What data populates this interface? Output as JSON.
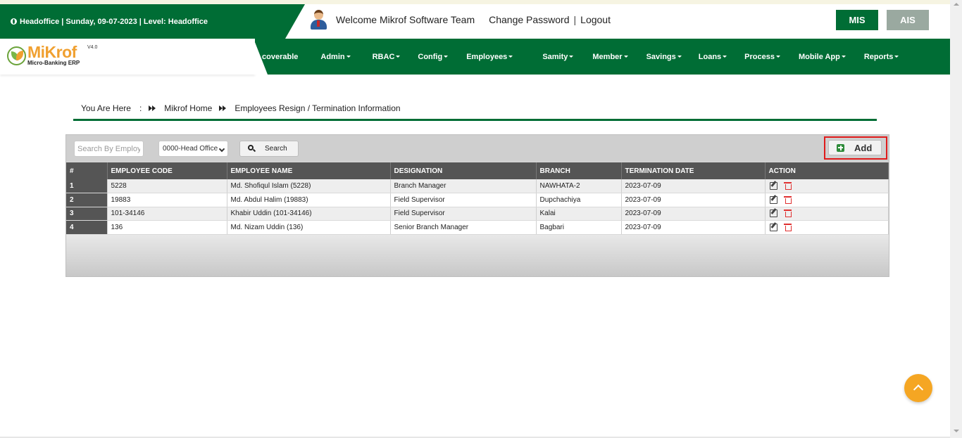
{
  "topbar": {
    "info": "Headoffice | Sunday, 09-07-2023 | Level: Headoffice",
    "welcome": "Welcome Mikrof Software Team",
    "change_password": "Change Password",
    "separator": "|",
    "logout": "Logout",
    "mis_label": "MIS",
    "ais_label": "AIS"
  },
  "logo": {
    "name": "MiKrof",
    "version": "V4.0",
    "subtitle": "Micro-Banking ERP"
  },
  "menu": [
    {
      "label": "coverable",
      "caret": false
    },
    {
      "label": "Admin",
      "caret": true
    },
    {
      "label": "RBAC",
      "caret": true
    },
    {
      "label": "Config",
      "caret": true
    },
    {
      "label": "Employees",
      "caret": true
    },
    {
      "label": "Samity",
      "caret": true
    },
    {
      "label": "Member",
      "caret": true
    },
    {
      "label": "Savings",
      "caret": true
    },
    {
      "label": "Loans",
      "caret": true
    },
    {
      "label": "Process",
      "caret": true
    },
    {
      "label": "Mobile App",
      "caret": true
    },
    {
      "label": "Reports",
      "caret": true
    }
  ],
  "breadcrumb": {
    "you_are_here": "You Are Here",
    "colon": ":",
    "home": "Mikrof Home",
    "current": "Employees Resign / Termination Information"
  },
  "filters": {
    "search_placeholder": "Search By Employee",
    "branch_value": "0000-Head Office",
    "search_button": "Search",
    "add_button": "Add"
  },
  "table": {
    "headers": [
      "#",
      "EMPLOYEE CODE",
      "EMPLOYEE NAME",
      "DESIGNATION",
      "BRANCH",
      "TERMINATION DATE",
      "ACTION"
    ],
    "rows": [
      {
        "idx": "1",
        "code": "5228",
        "name": "Md. Shofiqul Islam (5228)",
        "designation": "Branch Manager",
        "branch": "NAWHATA-2",
        "date": "2023-07-09"
      },
      {
        "idx": "2",
        "code": "19883",
        "name": "Md. Abdul Halim (19883)",
        "designation": "Field Supervisor",
        "branch": "Dupchachiya",
        "date": "2023-07-09"
      },
      {
        "idx": "3",
        "code": "101-34146",
        "name": "Khabir Uddin (101-34146)",
        "designation": "Field Supervisor",
        "branch": "Kalai",
        "date": "2023-07-09"
      },
      {
        "idx": "4",
        "code": "136",
        "name": "Md. Nizam Uddin (136)",
        "designation": "Senior Branch Manager",
        "branch": "Bagbari",
        "date": "2023-07-09"
      }
    ]
  },
  "colors": {
    "brand_green": "#006d35",
    "accent_orange": "#f5a623",
    "highlight_red": "#e01b1b"
  },
  "icons": {
    "globe": "globe-icon",
    "avatar": "user-avatar-icon",
    "search": "search-icon",
    "add": "plus-square-icon",
    "edit": "edit-icon",
    "delete": "trash-icon",
    "scroll_top": "chevron-up-icon"
  }
}
